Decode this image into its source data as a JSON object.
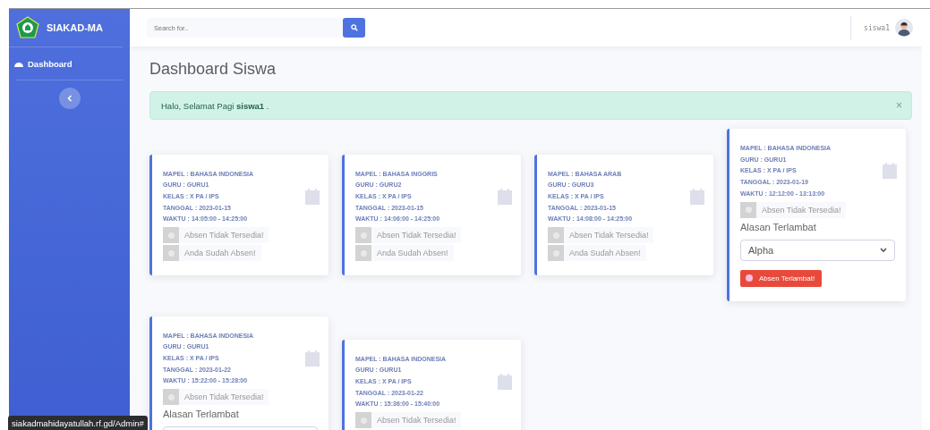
{
  "sidebar": {
    "brand": "SIAKAD-MA",
    "items": [
      {
        "label": "Dashboard",
        "selected": true
      }
    ]
  },
  "topbar": {
    "search": {
      "placeholder": "Search for.."
    },
    "user": "siswa1"
  },
  "page": {
    "title": "Dashboard Siswa"
  },
  "alert": {
    "text": "Halo, Selamat Pagi **siswa1** .",
    "close": "×"
  },
  "cards": [
    {
      "lines": [
        "MAPEL : BAHASA INDONESIA",
        "GURU : GURU1",
        "KELAS : X PA / IPS",
        "TANGGAL : 2023-01-15",
        "WAKTU : 14:05:00 - 14:25:00"
      ],
      "statuses": [
        "Absen Tidak Tersedia!",
        "Anda Sudah Absen!"
      ]
    },
    {
      "lines": [
        "MAPEL : BAHASA INGGRIS",
        "GURU : GURU2",
        "KELAS : X PA / IPS",
        "TANGGAL : 2023-01-15",
        "WAKTU : 14:06:00 - 14:25:00"
      ],
      "statuses": [
        "Absen Tidak Tersedia!",
        "Anda Sudah Absen!"
      ]
    },
    {
      "lines": [
        "MAPEL : BAHASA ARAB",
        "GURU : GURU3",
        "KELAS : X PA / IPS",
        "TANGGAL : 2023-01-15",
        "WAKTU : 14:08:00 - 14:25:00"
      ],
      "statuses": [
        "Absen Tidak Tersedia!",
        "Anda Sudah Absen!"
      ]
    },
    {
      "lines": [
        "MAPEL : BAHASA INDONESIA",
        "GURU : GURU1",
        "KELAS : X PA / IPS",
        "TANGGAL : 2023-01-19",
        "WAKTU : 12:12:00 - 13:13:00"
      ],
      "statuses": [
        "Absen Tidak Tersedia!"
      ],
      "late": {
        "label": "Alasan Terlambat",
        "value": "Alpha",
        "button": "Absen Terlambat!"
      }
    },
    {
      "lines": [
        "MAPEL : BAHASA INDONESIA",
        "GURU : GURU1",
        "KELAS : X PA / IPS",
        "TANGGAL : 2023-01-22",
        "WAKTU : 15:22:00 - 15:28:00"
      ],
      "statuses": [
        "Absen Tidak Tersedia!"
      ],
      "late": {
        "label": "Alasan Terlambat"
      }
    },
    {
      "lines": [
        "MAPEL : BAHASA INDONESIA",
        "GURU : GURU1",
        "KELAS : X PA / IPS",
        "TANGGAL : 2023-01-22",
        "WAKTU : 15:36:00 - 15:40:00"
      ],
      "statuses": [
        "Absen Tidak Tersedia!"
      ]
    }
  ],
  "status_url": "siakadmahidayatullah.rf.gd/Admin#"
}
